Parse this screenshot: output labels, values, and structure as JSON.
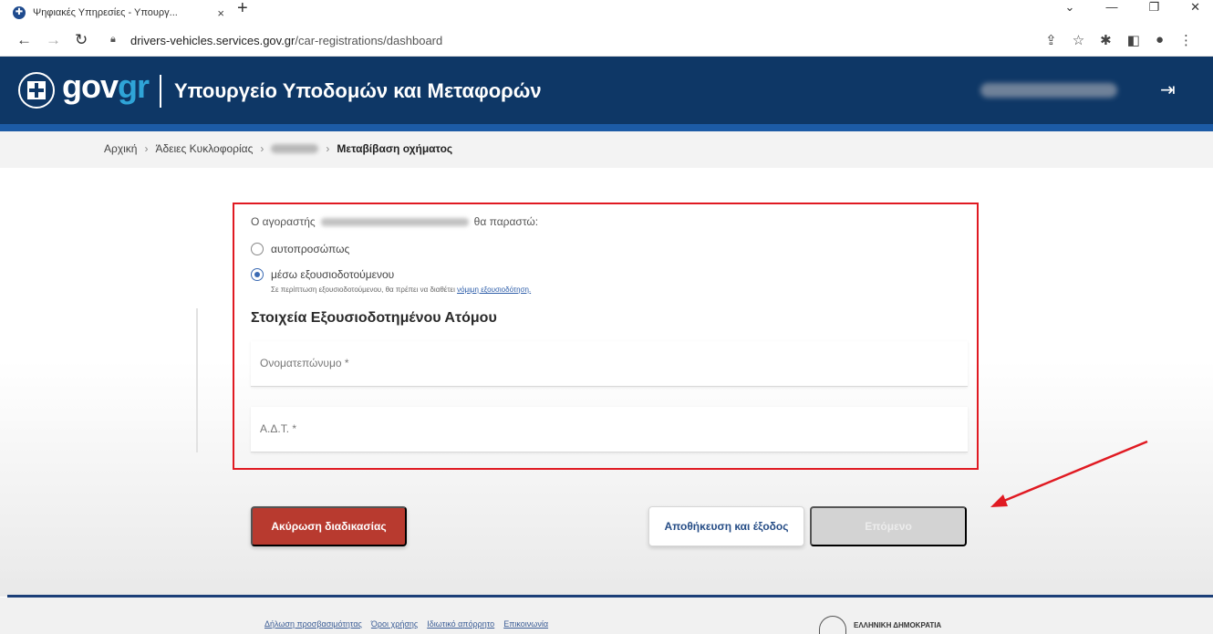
{
  "browser": {
    "tab_title": "Ψηφιακές Υπηρεσίες - Υπουργ...",
    "tab_close": "×",
    "new_tab": "+",
    "url_domain": "drivers-vehicles.services.gov.gr",
    "url_path": "/car-registrations/dashboard",
    "controls": [
      "⌄",
      "—",
      "❐",
      "✕"
    ]
  },
  "header": {
    "logo_gov": "gov",
    "logo_gr": "gr",
    "ministry": "Υπουργείο Υποδομών και Μεταφορών",
    "logout_icon": "⇥"
  },
  "breadcrumb": {
    "items": [
      "Αρχική",
      "Άδειες Κυκλοφορίας"
    ],
    "current": "Μεταβίβαση οχήματος",
    "sep": "›"
  },
  "form": {
    "buyer_prefix": "Ο αγοραστής",
    "buyer_suffix": "θα παραστώ:",
    "option_in_person": "αυτοπροσώπως",
    "option_authorized": "μέσω εξουσιοδοτούμενου",
    "selected_option": "μέσω εξουσιοδοτούμενου",
    "hint_text": "Σε περίπτωση εξουσιοδοτούμενου, θα πρέπει να διαθέτει",
    "hint_link": "νόμιμη εξουσιοδότηση.",
    "section_title": "Στοιχεία Εξουσιοδοτημένου Ατόμου",
    "fullname_label": "Ονοματεπώνυμο *",
    "fullname_value": "",
    "id_label": "Α.Δ.Τ. *",
    "id_value": ""
  },
  "buttons": {
    "cancel": "Ακύρωση διαδικασίας",
    "save_exit": "Αποθήκευση και έξοδος",
    "next": "Επόμενο"
  },
  "footer": {
    "links": [
      "Δήλωση προσβασιμότητας",
      "Όροι χρήσης",
      "Ιδιωτικό απόρρητο",
      "Επικοινωνία"
    ],
    "brand": "ΕΛΛΗΝΙΚΗ ΔΗΜΟΚΡΑΤΙΑ"
  },
  "colors": {
    "header_bg": "#0e3766",
    "accent_blue": "#2fa4d7",
    "highlight_red": "#e01a22",
    "cancel_bg": "#b83a2f"
  }
}
